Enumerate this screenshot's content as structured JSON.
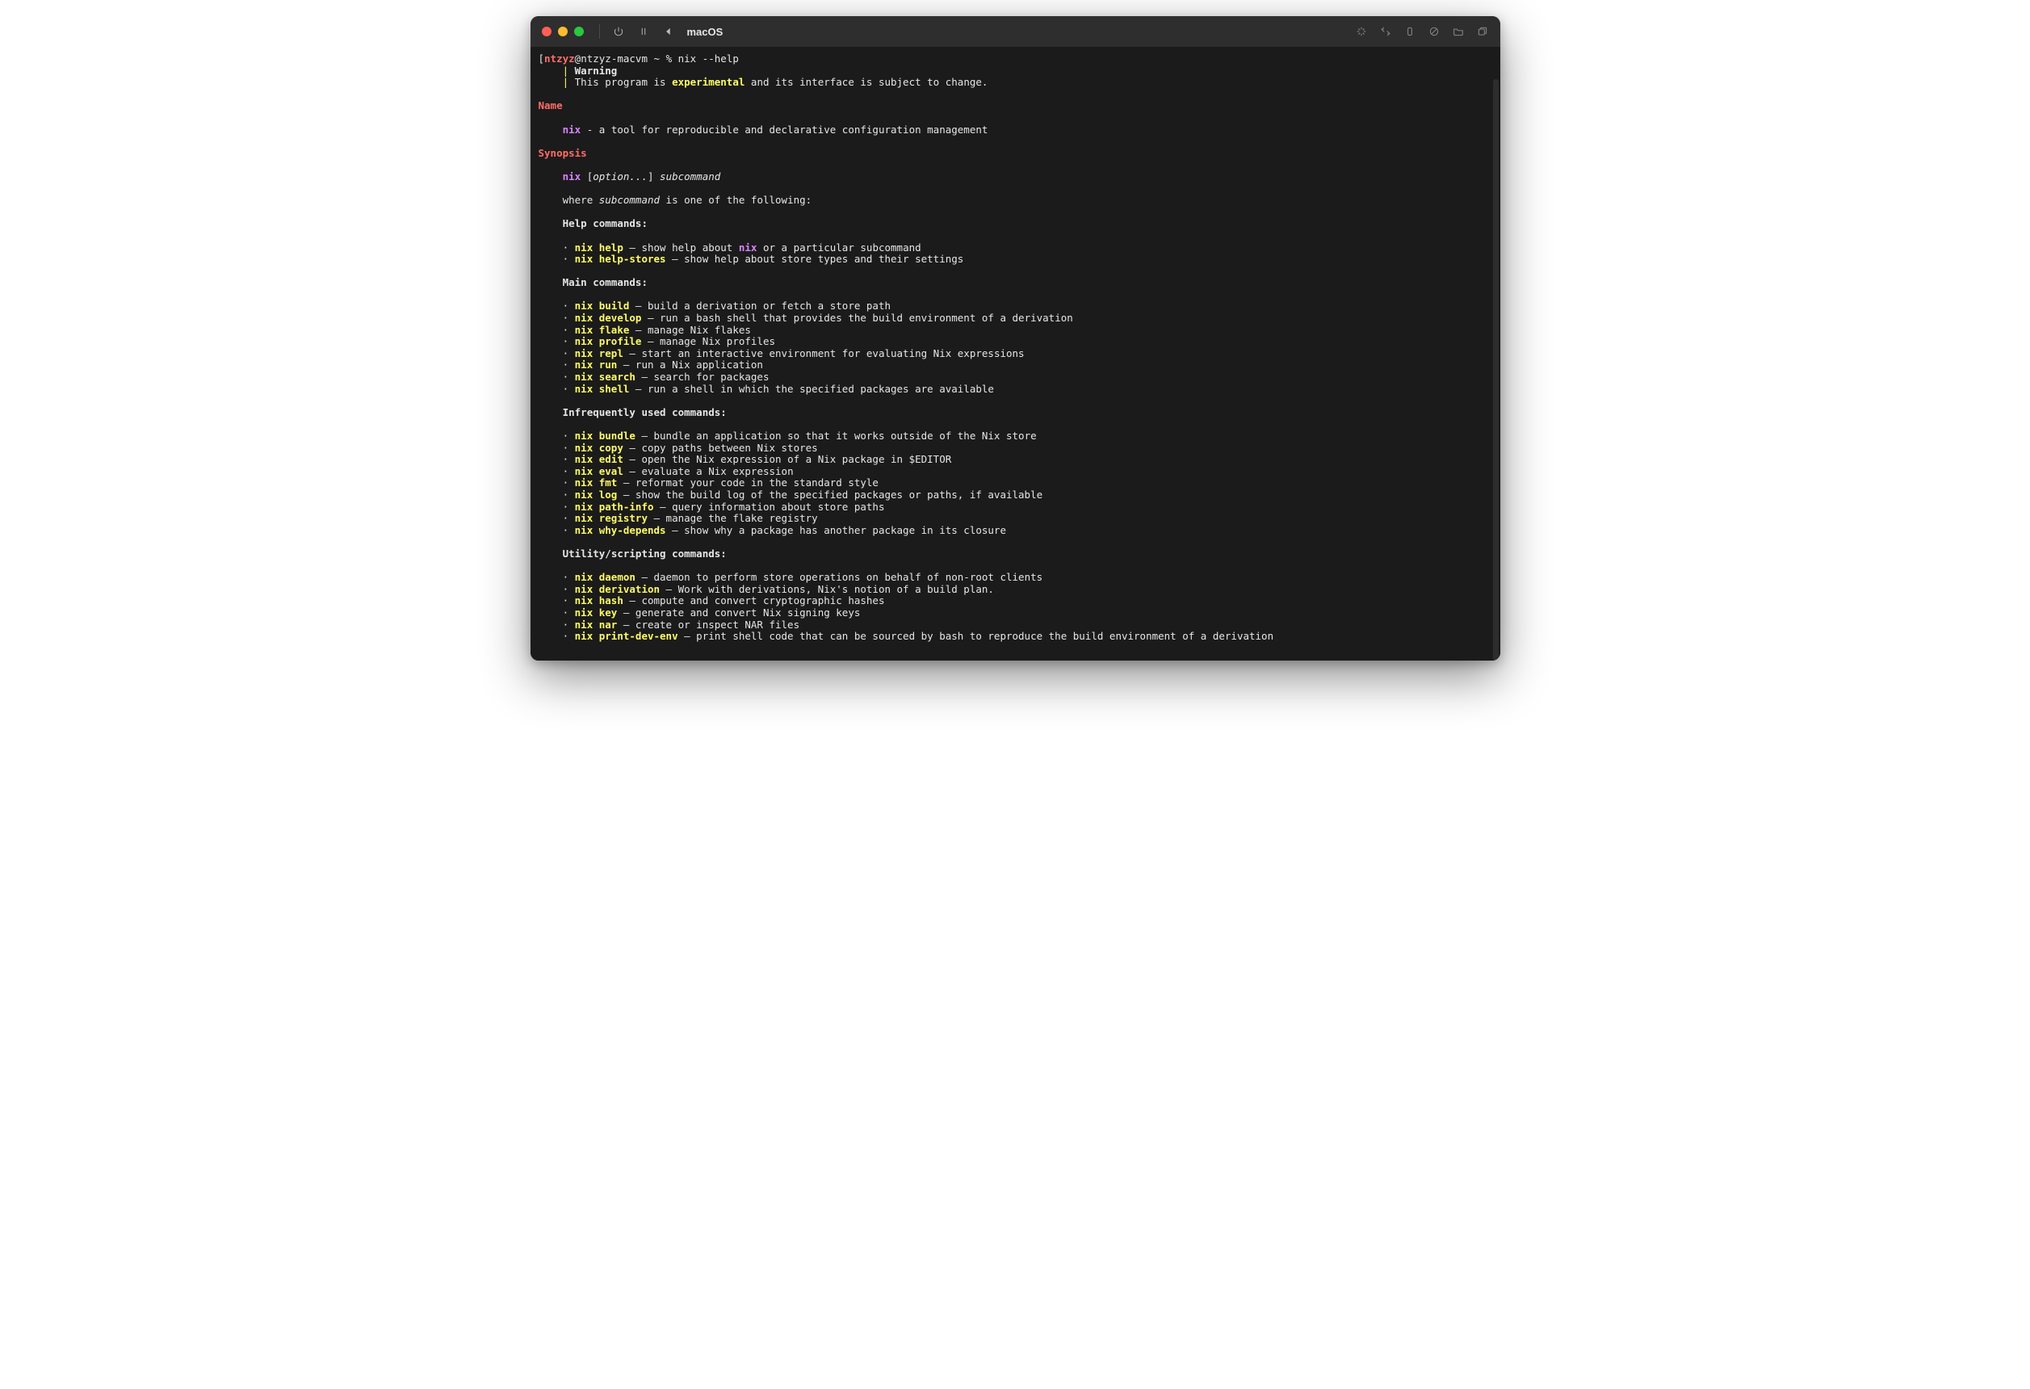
{
  "window": {
    "title": "macOS"
  },
  "prompt": {
    "bracket_open": "[",
    "user": "ntzyz",
    "at": "@",
    "host": "ntzyz-macvm",
    "rest": " ~ % nix --help",
    "bracket_close": ""
  },
  "warning": {
    "pipe": "    | ",
    "label": "Warning",
    "line2_pre": "    | This program is ",
    "line2_hl": "experimental",
    "line2_post": " and its interface is subject to change."
  },
  "sections": {
    "name": "Name",
    "name_cmd": "nix",
    "name_desc": " - a tool for reproducible and declarative configuration management",
    "synopsis": "Synopsis",
    "syn_cmd": "nix",
    "syn_args1": " [",
    "syn_opt": "option...",
    "syn_args2": "] ",
    "syn_sub": "subcommand",
    "where_pre": "    where ",
    "where_sub": "subcommand",
    "where_post": " is one of the following:"
  },
  "groups": [
    {
      "heading": "Help commands:",
      "items": [
        {
          "pre": "nix ",
          "cmd": "nix help",
          "desc": " — show help about ",
          "inline_cmd": "nix",
          "desc2": " or a particular subcommand"
        },
        {
          "cmd": "nix help-stores",
          "desc": " — show help about store types and their settings"
        }
      ]
    },
    {
      "heading": "Main commands:",
      "items": [
        {
          "cmd": "nix build",
          "desc": " — build a derivation or fetch a store path"
        },
        {
          "cmd": "nix develop",
          "desc": " — run a bash shell that provides the build environment of a derivation"
        },
        {
          "cmd": "nix flake",
          "desc": " — manage Nix flakes"
        },
        {
          "cmd": "nix profile",
          "desc": " — manage Nix profiles"
        },
        {
          "cmd": "nix repl",
          "desc": " — start an interactive environment for evaluating Nix expressions"
        },
        {
          "cmd": "nix run",
          "desc": " — run a Nix application"
        },
        {
          "cmd": "nix search",
          "desc": " — search for packages"
        },
        {
          "cmd": "nix shell",
          "desc": " — run a shell in which the specified packages are available"
        }
      ]
    },
    {
      "heading": "Infrequently used commands:",
      "items": [
        {
          "cmd": "nix bundle",
          "desc": " — bundle an application so that it works outside of the Nix store"
        },
        {
          "cmd": "nix copy",
          "desc": " — copy paths between Nix stores"
        },
        {
          "cmd": "nix edit",
          "desc": " — open the Nix expression of a Nix package in $EDITOR"
        },
        {
          "cmd": "nix eval",
          "desc": " — evaluate a Nix expression"
        },
        {
          "cmd": "nix fmt",
          "desc": " — reformat your code in the standard style"
        },
        {
          "cmd": "nix log",
          "desc": " — show the build log of the specified packages or paths, if available"
        },
        {
          "cmd": "nix path-info",
          "desc": " — query information about store paths"
        },
        {
          "cmd": "nix registry",
          "desc": " — manage the flake registry"
        },
        {
          "cmd": "nix why-depends",
          "desc": " — show why a package has another package in its closure"
        }
      ]
    },
    {
      "heading": "Utility/scripting commands:",
      "items": [
        {
          "cmd": "nix daemon",
          "desc": " — daemon to perform store operations on behalf of non-root clients"
        },
        {
          "cmd": "nix derivation",
          "desc": " — Work with derivations, Nix's notion of a build plan."
        },
        {
          "cmd": "nix hash",
          "desc": " — compute and convert cryptographic hashes"
        },
        {
          "cmd": "nix key",
          "desc": " — generate and convert Nix signing keys"
        },
        {
          "cmd": "nix nar",
          "desc": " — create or inspect NAR files"
        },
        {
          "cmd": "nix print-dev-env",
          "desc": " — print shell code that can be sourced by bash to reproduce the build environment of a derivation"
        }
      ]
    }
  ],
  "bullet": "    · "
}
